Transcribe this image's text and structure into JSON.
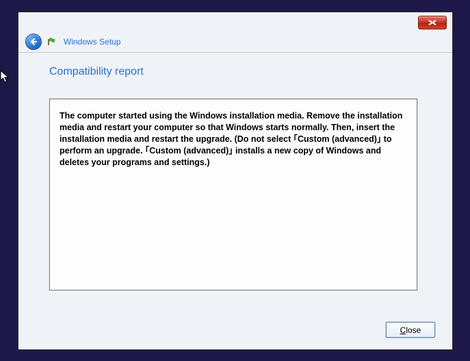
{
  "header": {
    "app_title": "Windows Setup"
  },
  "page": {
    "title": "Compatibility report"
  },
  "report": {
    "message": "The computer started using the Windows installation media. Remove the installation media and restart your computer so that Windows starts normally. Then, insert the installation media and restart the upgrade. (Do not select ｢Custom (advanced)｣ to perform an upgrade. ｢Custom (advanced)｣ installs a new copy of Windows and deletes your programs and settings.)"
  },
  "footer": {
    "close_label": "Close",
    "close_accel": "C"
  }
}
